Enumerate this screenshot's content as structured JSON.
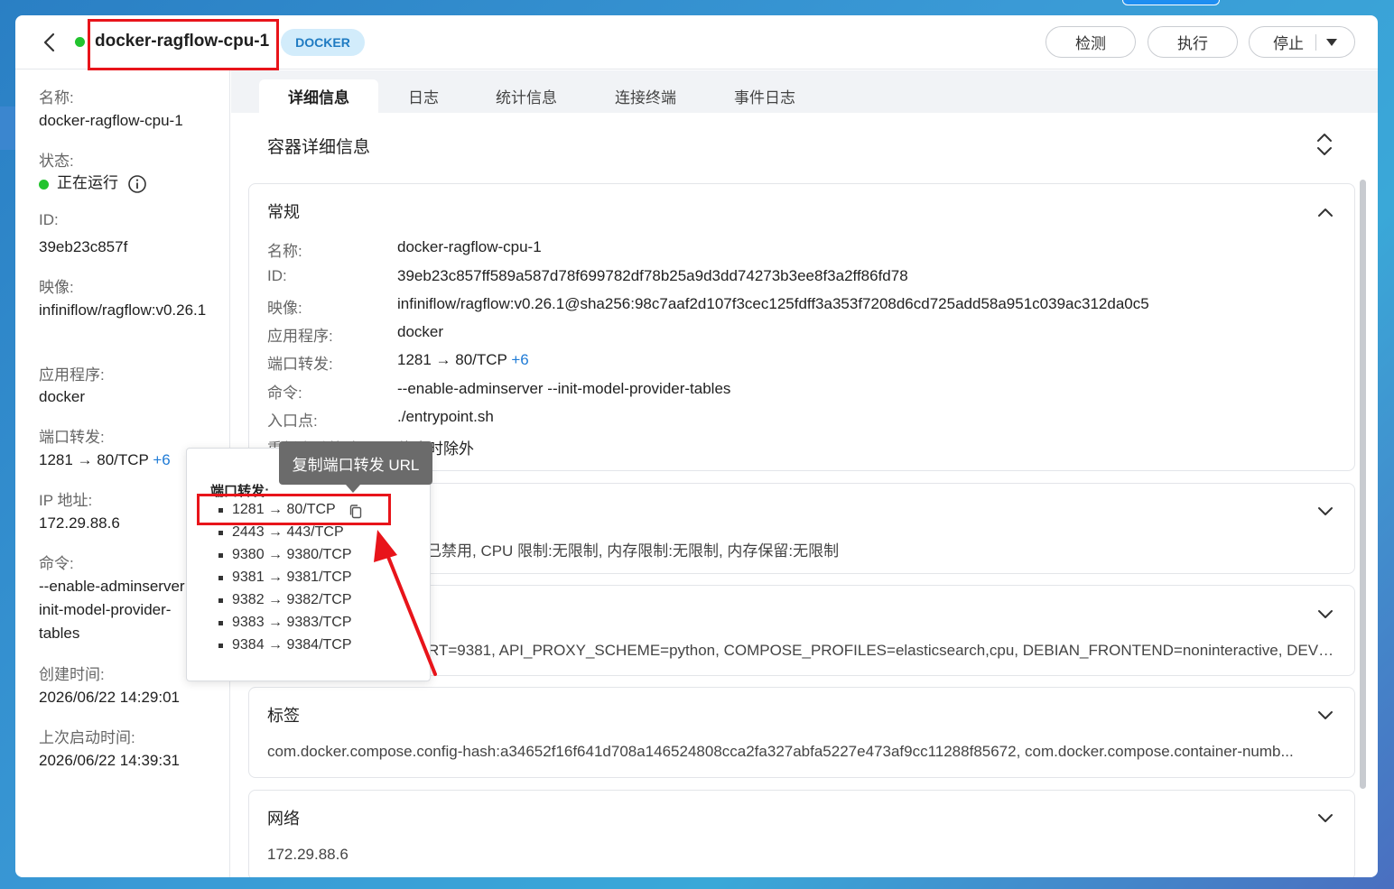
{
  "header": {
    "title": "docker-ragflow-cpu-1",
    "badge": "DOCKER",
    "buttons": {
      "detect": "检测",
      "exec": "执行",
      "stop": "停止"
    }
  },
  "sidebar": {
    "name_label": "名称:",
    "name_value": "docker-ragflow-cpu-1",
    "status_label": "状态:",
    "status_value": "正在运行",
    "id_label": "ID:",
    "id_value": "39eb23c857f",
    "image_label": "映像:",
    "image_value": "infiniflow/ragflow:v0.26.1",
    "app_label": "应用程序:",
    "app_value": "docker",
    "port_label": "端口转发:",
    "port_value": "1281 → 80/TCP",
    "port_more": "+6",
    "ip_label": "IP 地址:",
    "ip_value": "172.29.88.6",
    "cmd_label": "命令:",
    "cmd_value": "--enable-adminserver --init-model-provider-tables",
    "created_label": "创建时间:",
    "created_value": "2026/06/22 14:29:01",
    "started_label": "上次启动时间:",
    "started_value": "2026/06/22 14:39:31"
  },
  "tabs": [
    {
      "label": "详细信息"
    },
    {
      "label": "日志"
    },
    {
      "label": "统计信息"
    },
    {
      "label": "连接终端"
    },
    {
      "label": "事件日志"
    }
  ],
  "details": {
    "section_title": "容器详细信息",
    "general": {
      "title": "常规",
      "rows": [
        {
          "label": "名称:",
          "value": "docker-ragflow-cpu-1"
        },
        {
          "label": "ID:",
          "value": "39eb23c857ff589a587d78f699782df78b25a9d3dd74273b3ee8f3a2ff86fd78"
        },
        {
          "label": "映像:",
          "value": "infiniflow/ragflow:v0.26.1@sha256:98c7aaf2d107f3cec125fdff3a353f7208d6cd725add58a951c039ac312da0c5"
        },
        {
          "label": "应用程序:",
          "value": "docker"
        },
        {
          "label": "端口转发:",
          "value": "1281 → 80/TCP"
        },
        {
          "label": "命令:",
          "value": "--enable-adminserver --init-model-provider-tables"
        },
        {
          "label": "入口点:",
          "value": "./entrypoint.sh"
        },
        {
          "label": "重新启动策略:",
          "value": "停止时除外"
        }
      ],
      "port_more": "+6"
    },
    "resources_line": "已禁用, CPU 限制:无限制, 内存限制:无限制, 内存保留:无限制",
    "env_line": "RT=9381, API_PROXY_SCHEME=python, COMPOSE_PROFILES=elasticsearch,cpu, DEBIAN_FRONTEND=noninteractive, DEVICE=...",
    "labels": {
      "title": "标签",
      "line": "com.docker.compose.config-hash:a34652f16f641d708a146524808cca2fa327abfa5227e473af9cc11288f85672, com.docker.compose.container-numb..."
    },
    "network": {
      "title": "网络",
      "line": "172.29.88.6"
    }
  },
  "popover": {
    "title": "端口转发:",
    "items": [
      "1281 → 80/TCP",
      "2443 → 443/TCP",
      "9380 → 9380/TCP",
      "9381 → 9381/TCP",
      "9382 → 9382/TCP",
      "9383 → 9383/TCP",
      "9384 → 9384/TCP"
    ],
    "tooltip": "复制端口转发 URL"
  },
  "colors": {
    "accent": "#1f7bd6",
    "running": "#22c32e",
    "highlight": "#e8141a"
  }
}
